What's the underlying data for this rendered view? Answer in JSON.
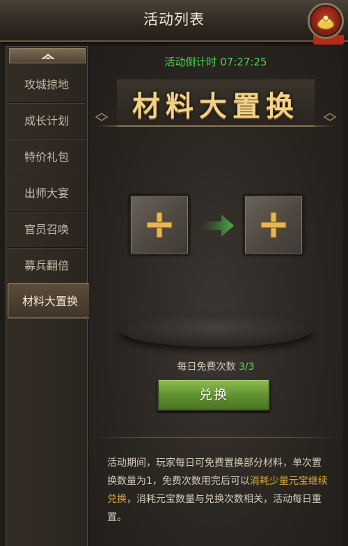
{
  "header": {
    "title": "活动列表"
  },
  "gift_button": {
    "icon": "gold-gift-icon"
  },
  "sidebar": {
    "items": [
      {
        "label": "攻城掠地",
        "active": false
      },
      {
        "label": "成长计划",
        "active": false
      },
      {
        "label": "特价礼包",
        "active": false
      },
      {
        "label": "出师大宴",
        "active": false
      },
      {
        "label": "官员召唤",
        "active": false
      },
      {
        "label": "募兵翻倍",
        "active": false
      },
      {
        "label": "材料大置换",
        "active": true
      }
    ]
  },
  "main": {
    "countdown": "活动倒计时 07:27:25",
    "banner_title": "材料大置换",
    "free_count_label": "每日免费次数",
    "free_count_value": "3/3",
    "exchange_button": "兑换",
    "description": {
      "part1": "活动期间，玩家每日可免费置换部分材料，单次置换数量为1，免费次数用完后可以",
      "highlight": "消耗少量元宝继续兑换",
      "part2": "，消耗元宝数量与兑换次数相关，活动每日重置。"
    }
  },
  "colors": {
    "countdown": "#4fd24a",
    "title_gold": "#f2d28a",
    "button_green": "#6f9f3a",
    "highlight": "#e0a83a"
  }
}
